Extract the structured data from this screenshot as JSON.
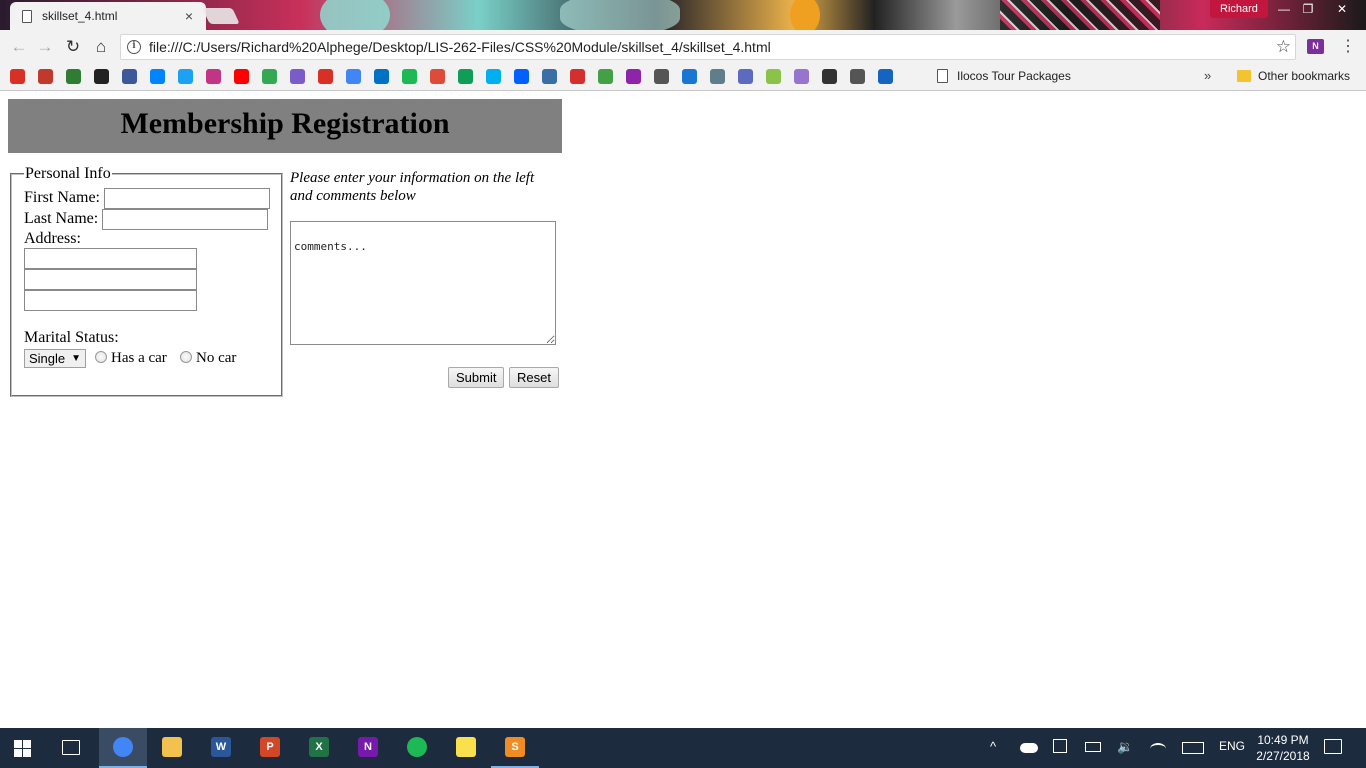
{
  "browser": {
    "tab_title": "skillset_4.html",
    "tab_close": "×",
    "profile_name": "Richard",
    "window_controls": {
      "minimize": "—",
      "restore": "❐",
      "close": "✕"
    },
    "nav": {
      "back": "←",
      "forward": "→",
      "reload": "↻",
      "home": "⌂"
    },
    "url": "file:///C:/Users/Richard%20Alphege/Desktop/LIS-262-Files/CSS%20Module/skillset_4/skillset_4.html",
    "star": "☆",
    "extension_label": "N",
    "menu": "⋮"
  },
  "bookmarks": {
    "icons": [
      {
        "name": "gmail-icon",
        "color": "#d93025"
      },
      {
        "name": "bookmark-2-icon",
        "color": "#c0392b"
      },
      {
        "name": "bookmark-3-icon",
        "color": "#2e7d32"
      },
      {
        "name": "github-icon",
        "color": "#222222"
      },
      {
        "name": "facebook-icon",
        "color": "#3b5998"
      },
      {
        "name": "messenger-icon",
        "color": "#0084ff"
      },
      {
        "name": "twitter-icon",
        "color": "#1da1f2"
      },
      {
        "name": "instagram-icon",
        "color": "#c13584"
      },
      {
        "name": "youtube-icon",
        "color": "#ff0000"
      },
      {
        "name": "google-photos-icon",
        "color": "#34a853"
      },
      {
        "name": "bookmark-11-icon",
        "color": "#7a5cc8"
      },
      {
        "name": "mail-icon",
        "color": "#d93025"
      },
      {
        "name": "chrome-icon",
        "color": "#4285f4"
      },
      {
        "name": "outlook-icon",
        "color": "#0072c6"
      },
      {
        "name": "spotify-icon",
        "color": "#1db954"
      },
      {
        "name": "google-plus-icon",
        "color": "#dd4b39"
      },
      {
        "name": "sheets-icon",
        "color": "#0f9d58"
      },
      {
        "name": "skype-icon",
        "color": "#00aff0"
      },
      {
        "name": "dropbox-icon",
        "color": "#0061ff"
      },
      {
        "name": "bookmark-20-icon",
        "color": "#3a6ea5"
      },
      {
        "name": "bookmark-21-icon",
        "color": "#d32f2f"
      },
      {
        "name": "bookmark-22-icon",
        "color": "#43a047"
      },
      {
        "name": "bookmark-23-icon",
        "color": "#8e24aa"
      },
      {
        "name": "page-icon",
        "color": "#555555"
      },
      {
        "name": "shield-icon",
        "color": "#1976d2"
      },
      {
        "name": "bookmark-26-icon",
        "color": "#607d8b"
      },
      {
        "name": "bookmark-27-icon",
        "color": "#5c6bc0"
      },
      {
        "name": "bookmark-28-icon",
        "color": "#8bc34a"
      },
      {
        "name": "bookmark-29-icon",
        "color": "#9575cd"
      },
      {
        "name": "bookmark-30-icon",
        "color": "#333333"
      },
      {
        "name": "bookmark-31-icon",
        "color": "#555555"
      },
      {
        "name": "bookmark-32-icon",
        "color": "#1565c0"
      }
    ],
    "ilocos_label": "Ilocos Tour Packages",
    "more": "»",
    "other_label": "Other bookmarks"
  },
  "page": {
    "heading": "Membership Registration",
    "legend": "Personal Info",
    "first_name_label": "First Name:",
    "last_name_label": "Last Name:",
    "address_label": "Address:",
    "marital_label": "Marital Status:",
    "marital_selected": "Single",
    "select_arrow": "▼",
    "has_car_label": "Has a car",
    "no_car_label": "No car",
    "note": "Please enter your information on the left and comments below",
    "comments_value": "comments...",
    "submit_label": "Submit",
    "reset_label": "Reset"
  },
  "taskbar": {
    "apps": [
      {
        "name": "chrome",
        "letter": "",
        "color": "#4285f4"
      },
      {
        "name": "file-explorer",
        "letter": "",
        "color": "#f2c14e"
      },
      {
        "name": "word",
        "letter": "W",
        "color": "#2b579a"
      },
      {
        "name": "powerpoint",
        "letter": "P",
        "color": "#d24726"
      },
      {
        "name": "excel",
        "letter": "X",
        "color": "#217346"
      },
      {
        "name": "onenote",
        "letter": "N",
        "color": "#7719aa"
      },
      {
        "name": "spotify",
        "letter": "",
        "color": "#1db954"
      },
      {
        "name": "sticky-notes",
        "letter": "",
        "color": "#f9e04c"
      },
      {
        "name": "sublime-text",
        "letter": "S",
        "color": "#f08c24"
      }
    ],
    "tray": {
      "chevron": "^",
      "language": "ENG"
    },
    "time": "10:49 PM",
    "date": "2/27/2018"
  }
}
